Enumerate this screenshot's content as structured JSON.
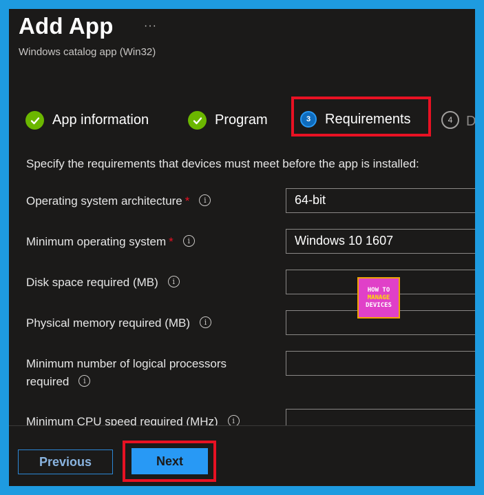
{
  "header": {
    "title": "Add App",
    "more": "···",
    "subtitle": "Windows catalog app (Win32)"
  },
  "steps": [
    {
      "label": "App information",
      "state": "completed"
    },
    {
      "label": "Program",
      "state": "completed"
    },
    {
      "label": "Requirements",
      "state": "active",
      "number": "3"
    },
    {
      "label": "D",
      "state": "pending",
      "number": "4"
    }
  ],
  "form": {
    "description": "Specify the requirements that devices must meet before the app is installed:",
    "fields": [
      {
        "label": "Operating system architecture",
        "required": true,
        "value": "64-bit"
      },
      {
        "label": "Minimum operating system",
        "required": true,
        "value": "Windows 10 1607"
      },
      {
        "label": "Disk space required (MB)",
        "required": false,
        "value": ""
      },
      {
        "label": "Physical memory required (MB)",
        "required": false,
        "value": ""
      },
      {
        "label_line1": "Minimum number of logical processors",
        "label_line2": "required",
        "required": false,
        "value": ""
      },
      {
        "label": "Minimum CPU speed required (MHz)",
        "required": false,
        "value": ""
      }
    ],
    "required_marker": "*",
    "info_glyph": "i"
  },
  "watermark": {
    "line1": "HOW TO",
    "line2": "MANAGE",
    "line3": "DEVICES"
  },
  "footer": {
    "previous_label": "Previous",
    "next_label": "Next"
  },
  "colors": {
    "accent": "#2899f5",
    "success": "#6bb700",
    "highlight": "#e81123",
    "background": "#1b1a19",
    "border": "#1e9be0"
  }
}
